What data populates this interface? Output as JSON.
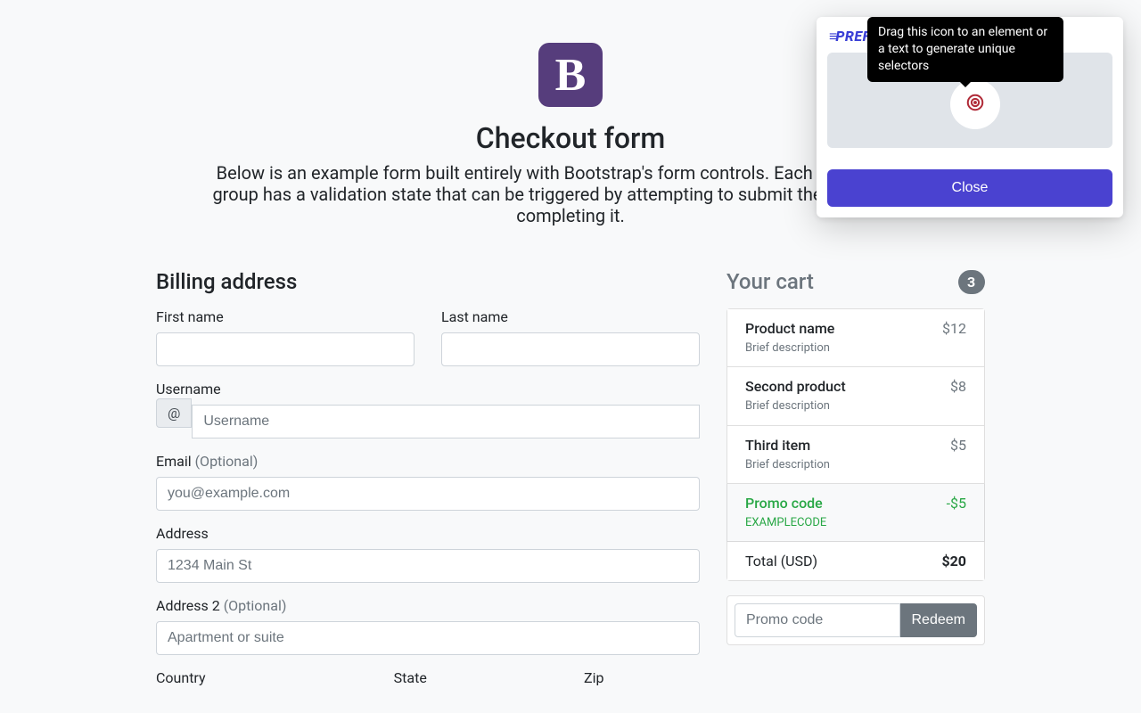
{
  "header": {
    "logo_letter": "B",
    "title": "Checkout form",
    "lead": "Below is an example form built entirely with Bootstrap's form controls. Each required form group has a validation state that can be triggered by attempting to submit the form without completing it."
  },
  "cart": {
    "title": "Your cart",
    "count": "3",
    "items": [
      {
        "name": "Product name",
        "desc": "Brief description",
        "price": "$12"
      },
      {
        "name": "Second product",
        "desc": "Brief description",
        "price": "$8"
      },
      {
        "name": "Third item",
        "desc": "Brief description",
        "price": "$5"
      }
    ],
    "promo": {
      "label": "Promo code",
      "code": "EXAMPLECODE",
      "amount": "-$5"
    },
    "total_label": "Total (USD)",
    "total_value": "$20",
    "promo_input_placeholder": "Promo code",
    "redeem_label": "Redeem"
  },
  "billing": {
    "title": "Billing address",
    "first_name_label": "First name",
    "last_name_label": "Last name",
    "username_label": "Username",
    "username_prefix": "@",
    "username_placeholder": "Username",
    "email_label": "Email ",
    "email_optional": "(Optional)",
    "email_placeholder": "you@example.com",
    "address_label": "Address",
    "address_placeholder": "1234 Main St",
    "address2_label": "Address 2 ",
    "address2_optional": "(Optional)",
    "address2_placeholder": "Apartment or suite",
    "country_label": "Country",
    "state_label": "State",
    "zip_label": "Zip"
  },
  "ext": {
    "brand": "PREFLIGHT",
    "tooltip": "Drag this icon to an element or a text to generate unique selectors",
    "close": "Close"
  }
}
